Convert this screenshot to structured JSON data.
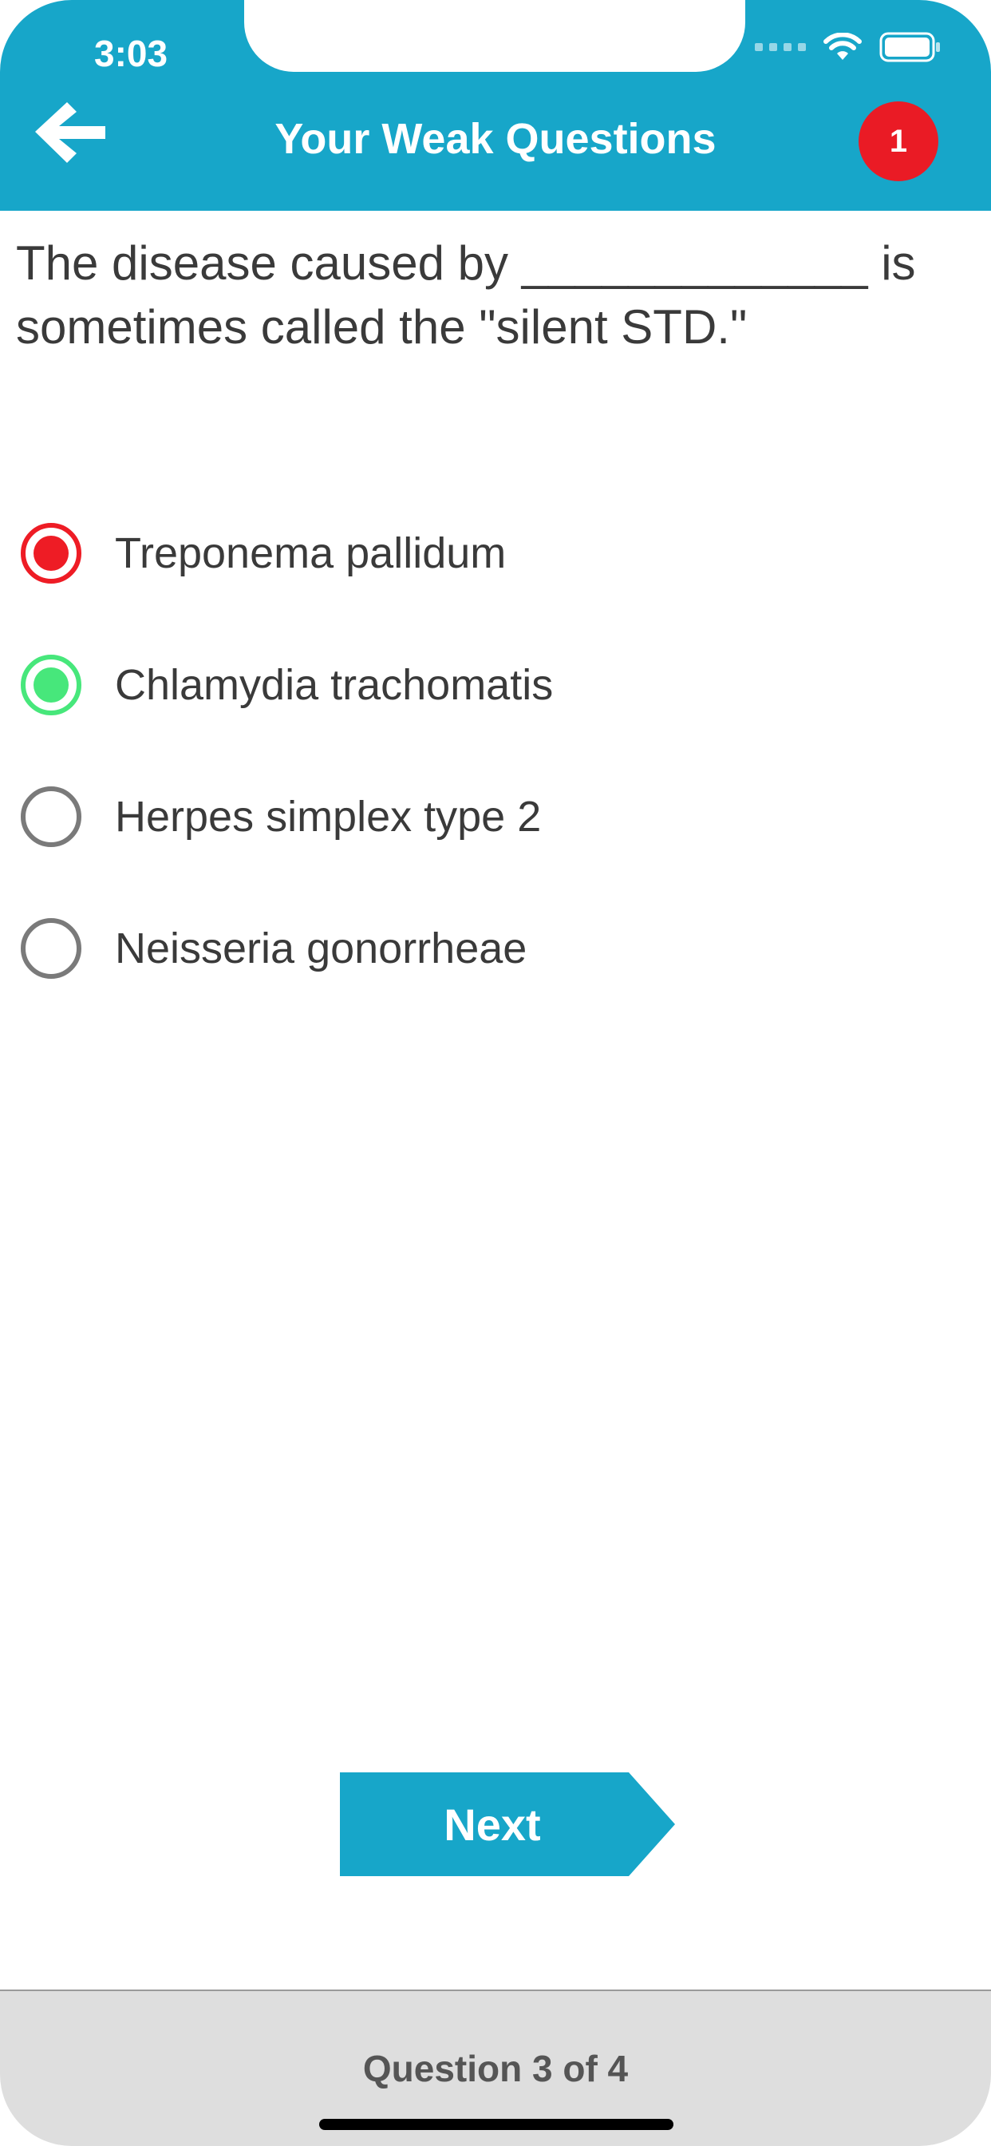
{
  "status_bar": {
    "time": "3:03"
  },
  "header": {
    "title": "Your Weak Questions",
    "badge_count": "1",
    "back_icon": "arrow-left-icon"
  },
  "question": {
    "text": "The disease caused by _____________ is sometimes called the \"silent STD.\""
  },
  "options": [
    {
      "label": "Treponema pallidum",
      "state": "selected-wrong"
    },
    {
      "label": "Chlamydia trachomatis",
      "state": "correct"
    },
    {
      "label": "Herpes simplex type 2",
      "state": "unselected"
    },
    {
      "label": "Neisseria gonorrheae",
      "state": "unselected"
    }
  ],
  "next_button": {
    "label": "Next"
  },
  "footer": {
    "progress_text": "Question 3 of 4"
  },
  "colors": {
    "primary": "#17a6c9",
    "wrong": "#ee1c25",
    "correct": "#47e77b",
    "badge": "#ea1b25",
    "footer_bg": "#dedede"
  }
}
